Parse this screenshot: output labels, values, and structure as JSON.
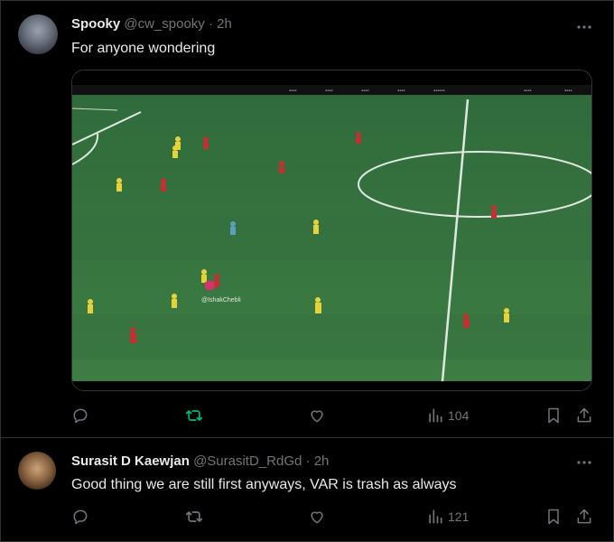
{
  "posts": [
    {
      "author_name": "Spooky",
      "author_handle": "@cw_spooky",
      "separator": "·",
      "time": "2h",
      "text": "For anyone wondering",
      "media": {
        "watermark": "@IshakChebli"
      },
      "views": "104",
      "repost_active": true
    },
    {
      "author_name": "Surasit D Kaewjan",
      "author_handle": "@SurasitD_RdGd",
      "separator": "·",
      "time": "2h",
      "text": "Good thing we are still first anyways, VAR is trash as always",
      "views": "121",
      "repost_active": false
    }
  ],
  "icons": {
    "more": "more-dots-icon",
    "reply": "reply-icon",
    "repost": "repost-icon",
    "like": "heart-icon",
    "views": "views-chart-icon",
    "bookmark": "bookmark-icon",
    "share": "share-icon"
  },
  "colors": {
    "background": "#000000",
    "text": "#e7e9ea",
    "secondary": "#71767b",
    "repost_active": "#00ba7c",
    "border": "#2f3336"
  }
}
